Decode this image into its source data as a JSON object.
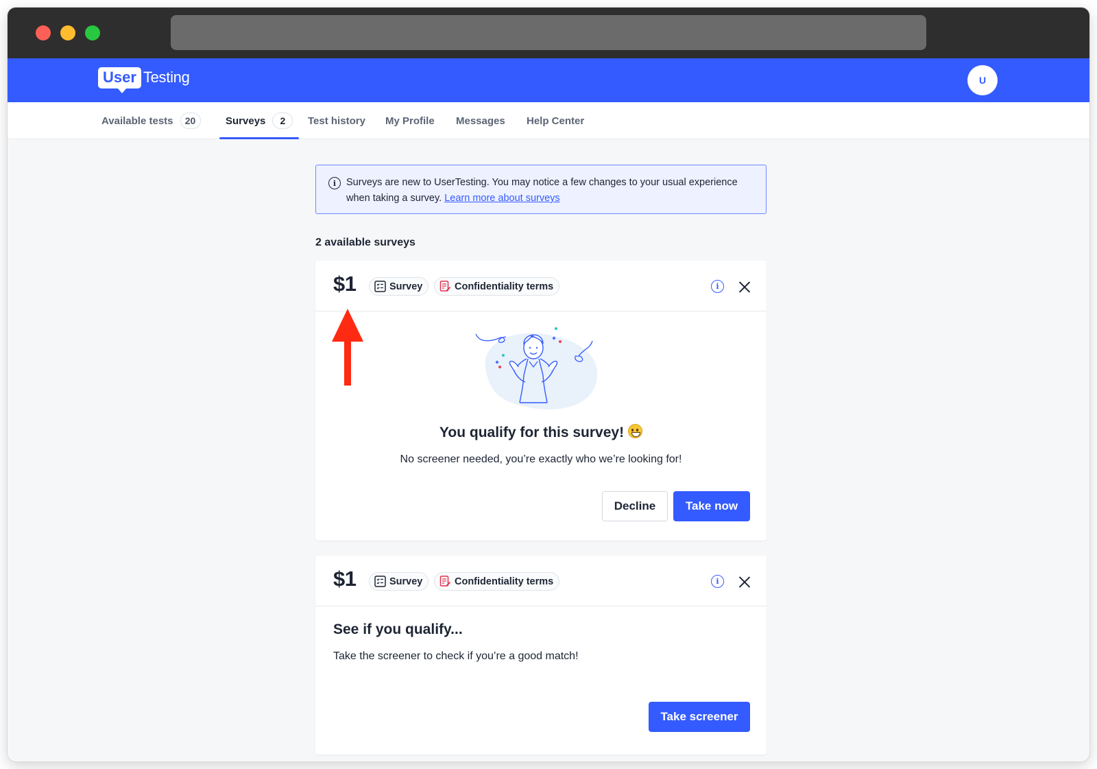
{
  "browser": {
    "traffic_lights": [
      "close",
      "minimize",
      "maximize"
    ]
  },
  "header": {
    "logo_user": "User",
    "logo_testing": "Testing",
    "avatar_initial": "U",
    "brand_color": "#345bff"
  },
  "nav": {
    "tabs": [
      {
        "label": "Available tests",
        "count": "20",
        "active": false
      },
      {
        "label": "Surveys",
        "count": "2",
        "active": true
      },
      {
        "label": "Test history",
        "active": false
      },
      {
        "label": "My Profile",
        "active": false
      },
      {
        "label": "Messages",
        "active": false
      },
      {
        "label": "Help Center",
        "active": false
      }
    ]
  },
  "notice": {
    "text": "Surveys are new to UserTesting. You may notice a few changes to your usual experience when taking a survey.",
    "link": "Learn more about surveys",
    "icon": "info-icon"
  },
  "surveys": {
    "count_label": "2 available surveys",
    "items": [
      {
        "price": "$1",
        "type_chip": "Survey",
        "terms_chip": "Confidentiality terms",
        "title": "You qualify for this survey!",
        "subtitle": "No screener needed, you’re exactly who we’re looking for!",
        "decline_label": "Decline",
        "primary_label": "Take now"
      },
      {
        "price": "$1",
        "type_chip": "Survey",
        "terms_chip": "Confidentiality terms",
        "title": "See if you qualify...",
        "subtitle": "Take the screener to check if you’re a good match!",
        "primary_label": "Take screener"
      }
    ]
  },
  "annotation": {
    "arrow_color": "#ff2a12",
    "arrow_direction": "up"
  }
}
